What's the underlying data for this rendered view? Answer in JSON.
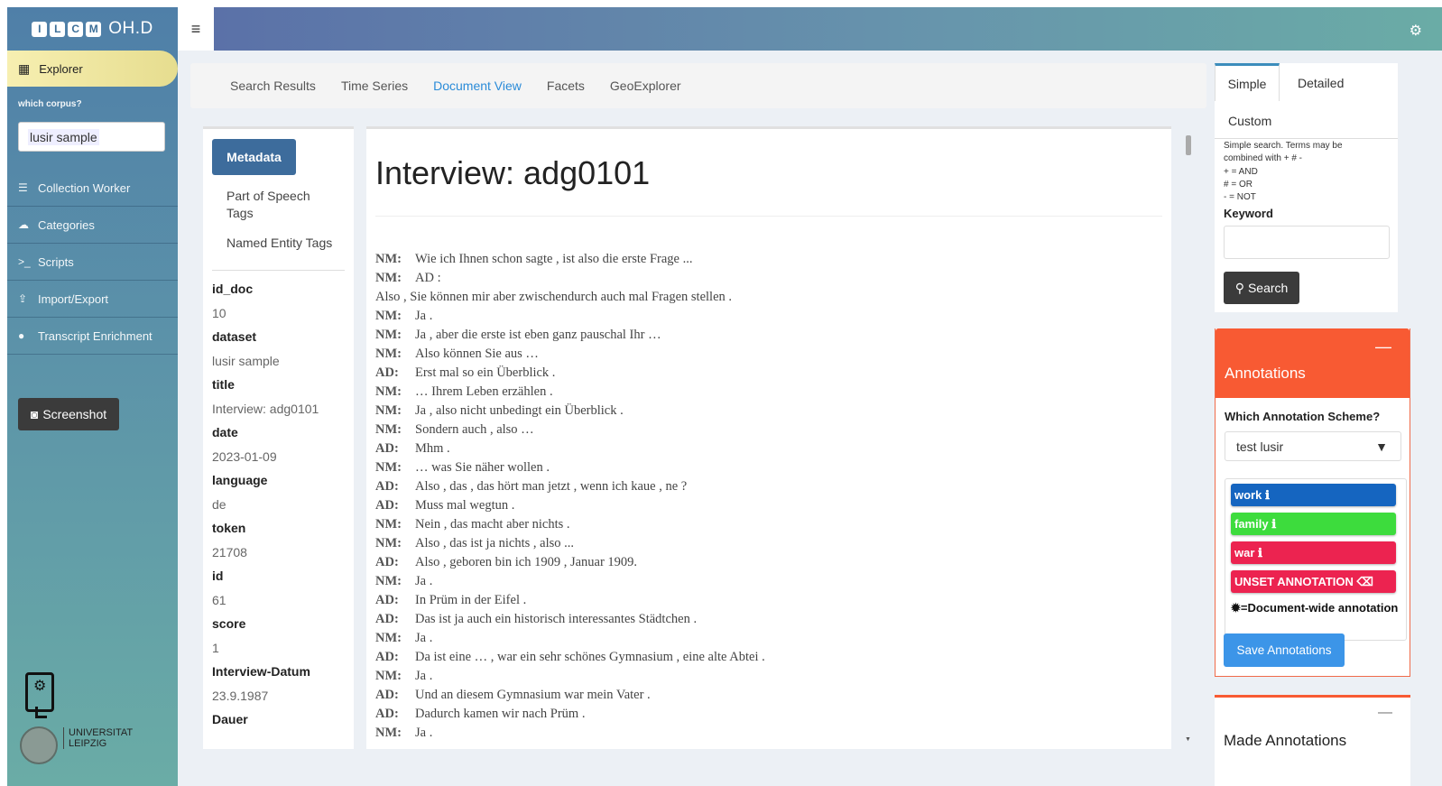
{
  "sidebar": {
    "logo_letters": [
      "I",
      "L",
      "C",
      "M"
    ],
    "logo_text": "OH.D",
    "explorer_label": "Explorer",
    "corpus_label": "which corpus?",
    "corpus_value": "lusir sample",
    "nav": [
      {
        "label": "Collection Worker",
        "icon": "database-icon"
      },
      {
        "label": "Categories",
        "icon": "cloud-icon"
      },
      {
        "label": "Scripts",
        "icon": "terminal-icon"
      },
      {
        "label": "Import/Export",
        "icon": "upload-icon"
      },
      {
        "label": "Transcript Enrichment",
        "icon": "comments-icon"
      }
    ],
    "screenshot_label": "Screenshot",
    "university": [
      "UNIVERSITAT",
      "LEIPZIG"
    ]
  },
  "tabs": [
    "Search Results",
    "Time Series",
    "Document View",
    "Facets",
    "GeoExplorer"
  ],
  "active_tab": "Document View",
  "metadata": {
    "button": "Metadata",
    "links": [
      "Part of Speech Tags",
      "Named Entity Tags"
    ],
    "fields": [
      {
        "key": "id_doc",
        "value": "10"
      },
      {
        "key": "dataset",
        "value": "lusir sample"
      },
      {
        "key": "title",
        "value": "Interview: adg0101"
      },
      {
        "key": "date",
        "value": "2023-01-09"
      },
      {
        "key": "language",
        "value": "de"
      },
      {
        "key": "token",
        "value": "21708"
      },
      {
        "key": "id",
        "value": "61"
      },
      {
        "key": "score",
        "value": "1"
      },
      {
        "key": "Interview-Datum",
        "value": "23.9.1987"
      },
      {
        "key": "Dauer",
        "value": ""
      }
    ]
  },
  "document": {
    "title": "Interview: adg0101",
    "utterances": [
      {
        "speaker": "NM:",
        "text": "Wie ich Ihnen schon sagte , ist also die erste Frage ..."
      },
      {
        "speaker": "NM:",
        "text": "AD :"
      },
      {
        "speaker": "",
        "text": "Also , Sie können mir aber zwischendurch auch mal Fragen stellen ."
      },
      {
        "speaker": "NM:",
        "text": "Ja ."
      },
      {
        "speaker": "NM:",
        "text": "Ja , aber die erste ist eben ganz pauschal Ihr …"
      },
      {
        "speaker": "NM:",
        "text": "Also können Sie aus …"
      },
      {
        "speaker": "AD:",
        "text": "Erst mal so ein Überblick ."
      },
      {
        "speaker": "NM:",
        "text": "… Ihrem Leben erzählen ."
      },
      {
        "speaker": "NM:",
        "text": "Ja , also nicht unbedingt ein Überblick ."
      },
      {
        "speaker": "NM:",
        "text": "Sondern auch , also …"
      },
      {
        "speaker": "AD:",
        "text": "Mhm ."
      },
      {
        "speaker": "NM:",
        "text": "… was Sie näher wollen ."
      },
      {
        "speaker": "AD:",
        "text": "Also , das , das hört man jetzt , wenn ich kaue , ne ?"
      },
      {
        "speaker": "AD:",
        "text": "Muss mal wegtun ."
      },
      {
        "speaker": "NM:",
        "text": "Nein , das macht aber nichts ."
      },
      {
        "speaker": "NM:",
        "text": "Also , das ist ja nichts , also ..."
      },
      {
        "speaker": "AD:",
        "text": "Also , geboren bin ich 1909 , Januar 1909."
      },
      {
        "speaker": "NM:",
        "text": "Ja ."
      },
      {
        "speaker": "AD:",
        "text": "In Prüm in der Eifel ."
      },
      {
        "speaker": "AD:",
        "text": "Das ist ja auch ein historisch interessantes Städtchen ."
      },
      {
        "speaker": "NM:",
        "text": "Ja ."
      },
      {
        "speaker": "AD:",
        "text": "Da ist eine … , war ein sehr schönes Gymnasium , eine alte Abtei ."
      },
      {
        "speaker": "NM:",
        "text": "Ja ."
      },
      {
        "speaker": "AD:",
        "text": "Und an diesem Gymnasium war mein Vater ."
      },
      {
        "speaker": "AD:",
        "text": "Dadurch kamen wir nach Prüm ."
      },
      {
        "speaker": "NM:",
        "text": "Ja ."
      }
    ]
  },
  "search": {
    "tabs": [
      "Simple",
      "Detailed",
      "Custom"
    ],
    "help": [
      "Simple search. Terms may be",
      "combined with + # -",
      "+ = AND",
      "# = OR",
      "- = NOT"
    ],
    "keyword_label": "Keyword",
    "keyword_value": "",
    "button": "Search"
  },
  "annotations": {
    "title": "Annotations",
    "scheme_label": "Which Annotation Scheme?",
    "scheme_value": "test lusir",
    "buttons": [
      {
        "label": "work",
        "color": "#1565c0"
      },
      {
        "label": "family",
        "color": "#3ddc3d"
      },
      {
        "label": "war",
        "color": "#ec2350"
      },
      {
        "label": "UNSET ANNOTATION",
        "color": "#ec2350"
      }
    ],
    "doc_wide_note": "=Document-wide annotation",
    "save_button": "Save Annotations"
  },
  "made_annotations": {
    "title": "Made Annotations"
  }
}
